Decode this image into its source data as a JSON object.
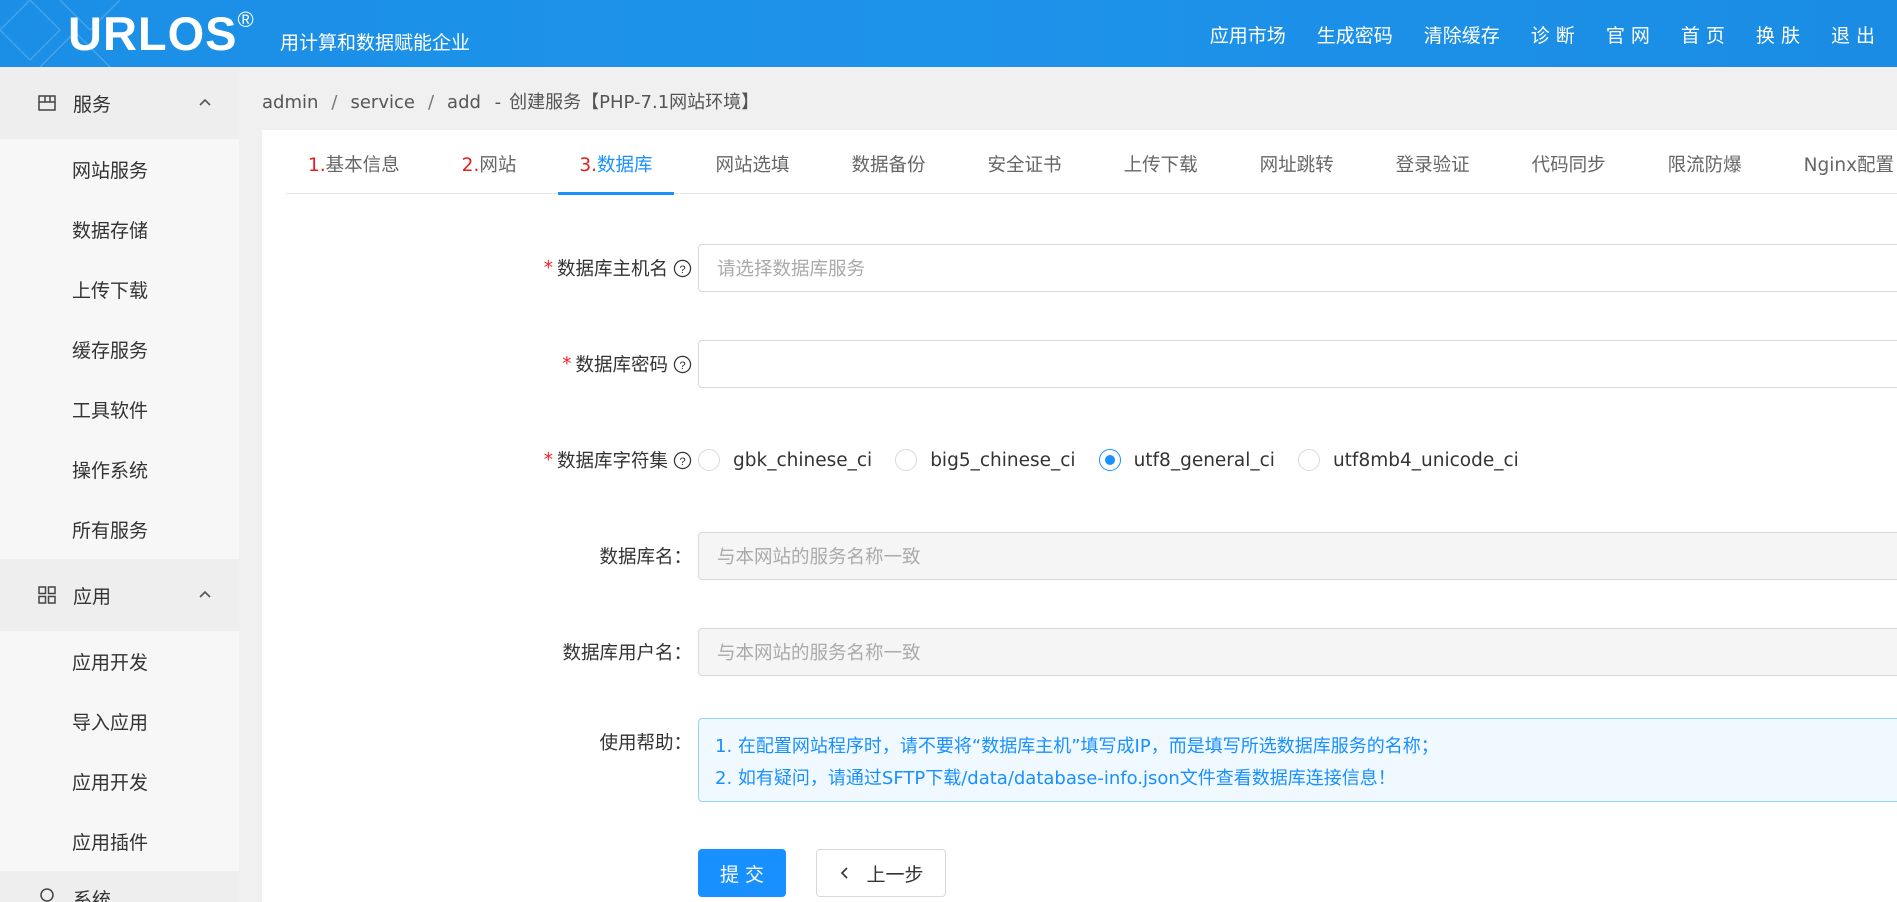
{
  "header": {
    "logo": "URLOS",
    "logo_mark": "®",
    "slogan": "用计算和数据赋能企业",
    "nav": [
      "应用市场",
      "生成密码",
      "清除缓存",
      "诊 断",
      "官 网",
      "首 页",
      "换 肤",
      "退 出"
    ]
  },
  "sidebar": {
    "groups": [
      {
        "label": "服务",
        "icon": "layout-icon",
        "items": [
          "网站服务",
          "数据存储",
          "上传下载",
          "缓存服务",
          "工具软件",
          "操作系统",
          "所有服务"
        ]
      },
      {
        "label": "应用",
        "icon": "grid-icon",
        "items": [
          "应用开发",
          "导入应用",
          "应用开发",
          "应用插件"
        ]
      }
    ],
    "partial_group": "系统"
  },
  "breadcrumb": [
    "admin",
    "service",
    "add"
  ],
  "breadcrumb_tail": "创建服务【PHP-7.1网站环境】",
  "tabs": [
    {
      "num": "1.",
      "label": "基本信息"
    },
    {
      "num": "2.",
      "label": "网站"
    },
    {
      "num": "3.",
      "label": "数据库"
    },
    {
      "num": "",
      "label": "网站选填"
    },
    {
      "num": "",
      "label": "数据备份"
    },
    {
      "num": "",
      "label": "安全证书"
    },
    {
      "num": "",
      "label": "上传下载"
    },
    {
      "num": "",
      "label": "网址跳转"
    },
    {
      "num": "",
      "label": "登录验证"
    },
    {
      "num": "",
      "label": "代码同步"
    },
    {
      "num": "",
      "label": "限流防爆"
    },
    {
      "num": "",
      "label": "Nginx配置"
    }
  ],
  "form": {
    "db_host": {
      "label": "数据库主机名",
      "placeholder": "请选择数据库服务",
      "value": ""
    },
    "db_password": {
      "label": "数据库密码",
      "value": ""
    },
    "charset": {
      "label": "数据库字符集",
      "options": [
        "gbk_chinese_ci",
        "big5_chinese_ci",
        "utf8_general_ci",
        "utf8mb4_unicode_ci"
      ],
      "selected": "utf8_general_ci"
    },
    "db_name": {
      "label": "数据库名：",
      "placeholder": "与本网站的服务名称一致"
    },
    "db_user": {
      "label": "数据库用户名：",
      "placeholder": "与本网站的服务名称一致"
    },
    "help": {
      "label": "使用帮助：",
      "line1": "1. 在配置网站程序时，请不要将“数据库主机”填写成IP，而是填写所选数据库服务的名称；",
      "line2": "2. 如有疑问，请通过SFTP下载/data/database-info.json文件查看数据库连接信息！"
    },
    "submit": "提 交",
    "prev": "上一步"
  }
}
